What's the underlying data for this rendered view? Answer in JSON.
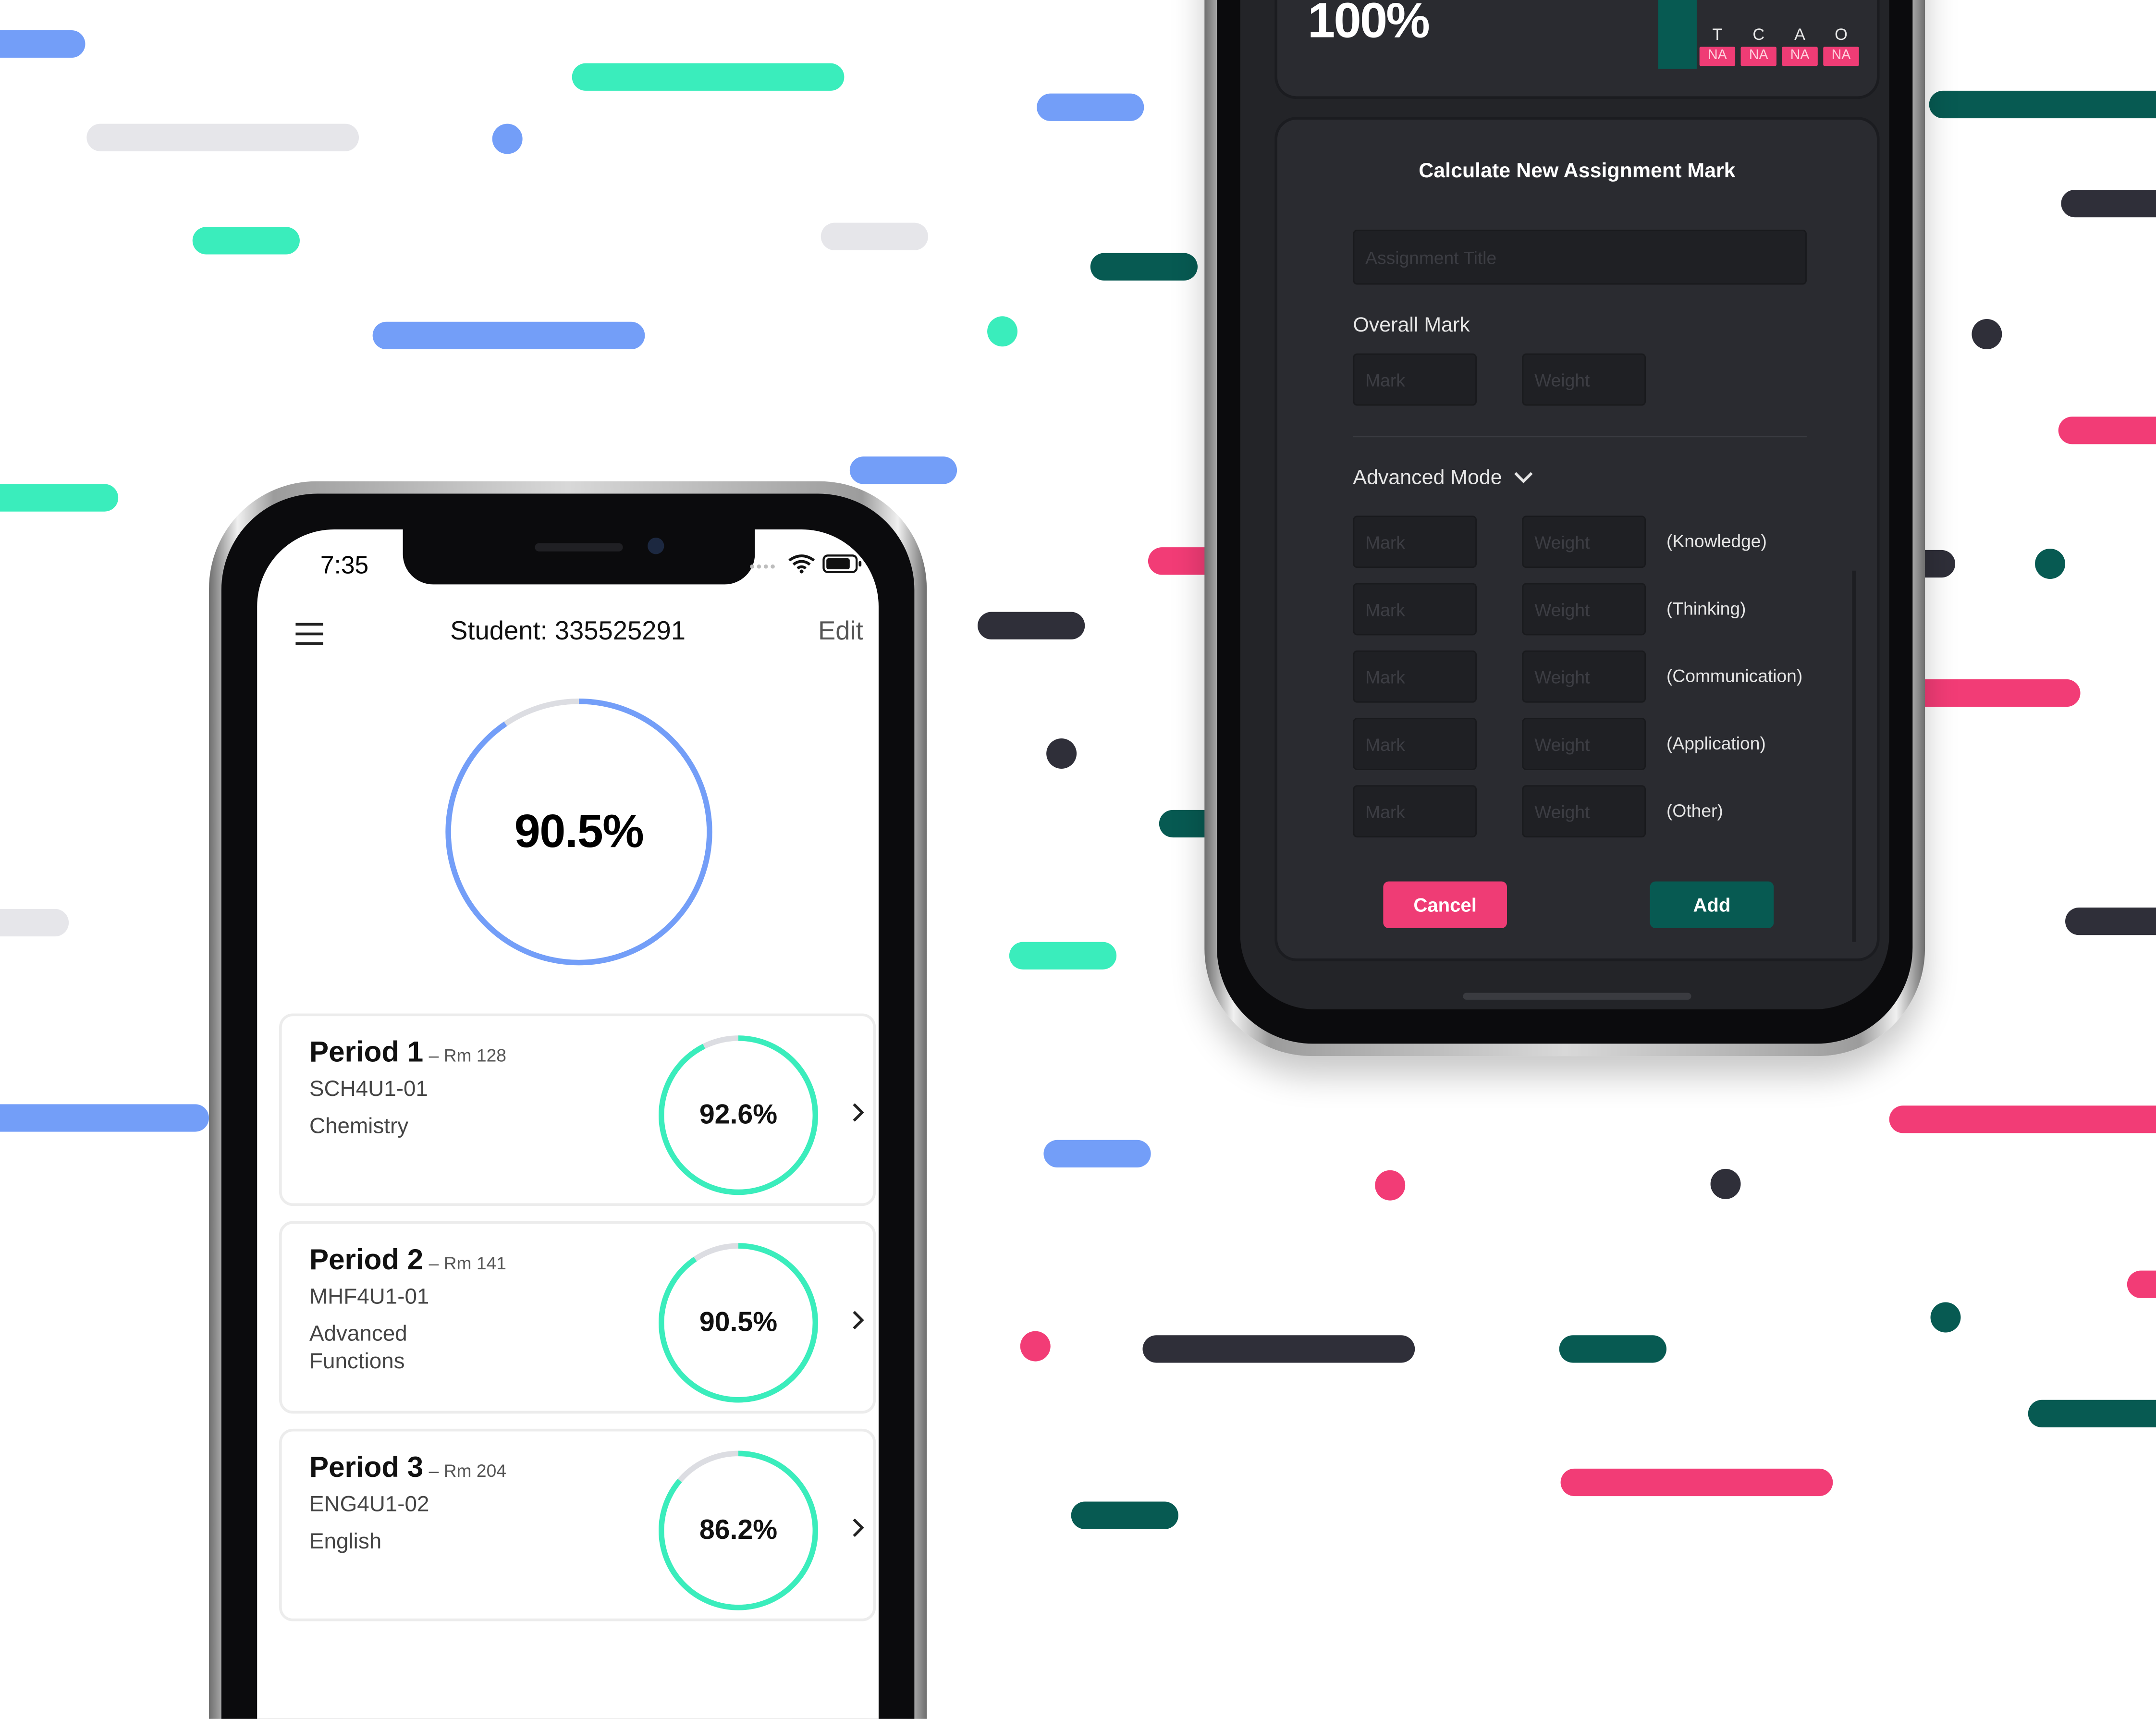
{
  "colors": {
    "blue": "#739ef8",
    "mint": "#3aedbc",
    "light_gray": "#e6e6ea",
    "dark_teal": "#075a52",
    "charcoal": "#2f2f39",
    "pink": "#f23c76",
    "dark_surface": "#2a2b30"
  },
  "right_phone": {
    "header_percent": "100%",
    "tcao_headers": [
      "T",
      "C",
      "A",
      "O"
    ],
    "tcao_values": [
      "NA",
      "NA",
      "NA",
      "NA"
    ],
    "dialog": {
      "title": "Calculate New Assignment Mark",
      "assignment_title_placeholder": "Assignment Title",
      "overall_mark_label": "Overall Mark",
      "mark_placeholder": "Mark",
      "weight_placeholder": "Weight",
      "advanced_mode_label": "Advanced Mode",
      "categories": [
        "(Knowledge)",
        "(Thinking)",
        "(Communication)",
        "(Application)",
        "(Other)"
      ],
      "cancel_label": "Cancel",
      "add_label": "Add"
    }
  },
  "left_phone": {
    "status_time": "7:35",
    "title": "Student: 335525291",
    "edit_label": "Edit",
    "overall_percent": "90.5%",
    "overall_value": 90.5,
    "periods": [
      {
        "period": "Period 1",
        "room": "– Rm 128",
        "code": "SCH4U1-01",
        "name": "Chemistry",
        "percent": "92.6%",
        "value": 92.6
      },
      {
        "period": "Period 2",
        "room": "– Rm 141",
        "code": "MHF4U1-01",
        "name": "Advanced Functions",
        "percent": "90.5%",
        "value": 90.5
      },
      {
        "period": "Period 3",
        "room": "– Rm 204",
        "code": "ENG4U1-02",
        "name": "English",
        "percent": "86.2%",
        "value": 86.2
      }
    ]
  }
}
